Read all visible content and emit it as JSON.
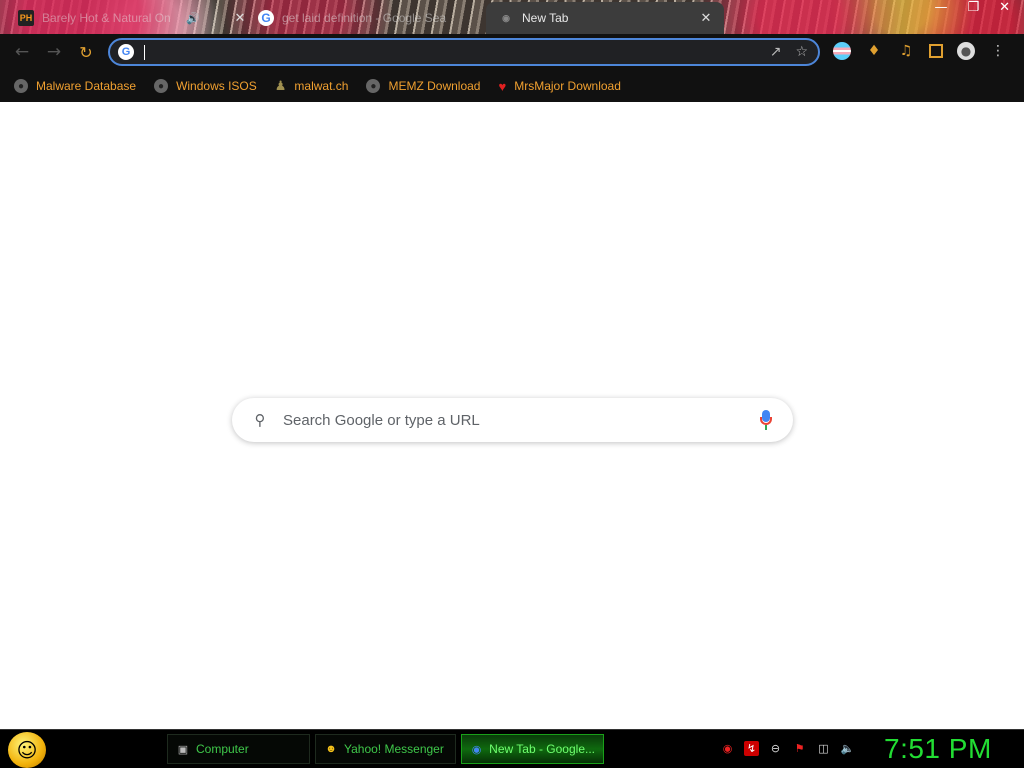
{
  "tabs": [
    {
      "title": "Barely Hot & Natural On",
      "favicon": "PH",
      "muted_icon": "speaker-icon"
    },
    {
      "title": "get laid definition - Google Sea",
      "favicon": "G"
    },
    {
      "title": "New Tab",
      "favicon": "chrome-icon"
    }
  ],
  "omnibox": {
    "value": "",
    "favicon": "G"
  },
  "bookmarks": [
    {
      "label": "Malware Database",
      "icon": "globe-icon"
    },
    {
      "label": "Windows ISOS",
      "icon": "globe-icon"
    },
    {
      "label": "malwat.ch",
      "icon": "person-icon"
    },
    {
      "label": "MEMZ Download",
      "icon": "globe-icon"
    },
    {
      "label": "MrsMajor Download",
      "icon": "heart-icon"
    }
  ],
  "search": {
    "placeholder": "Search Google or type a URL"
  },
  "taskbar": {
    "items": [
      {
        "label": "Computer"
      },
      {
        "label": "Yahoo! Messenger"
      },
      {
        "label": "New Tab - Google..."
      }
    ],
    "clock": "7:51 PM"
  },
  "colors": {
    "omnibox_border": "#4d86d9",
    "bookmark_text": "#f0a030",
    "taskbar_text": "#3fc84a",
    "clock": "#22dd33"
  }
}
